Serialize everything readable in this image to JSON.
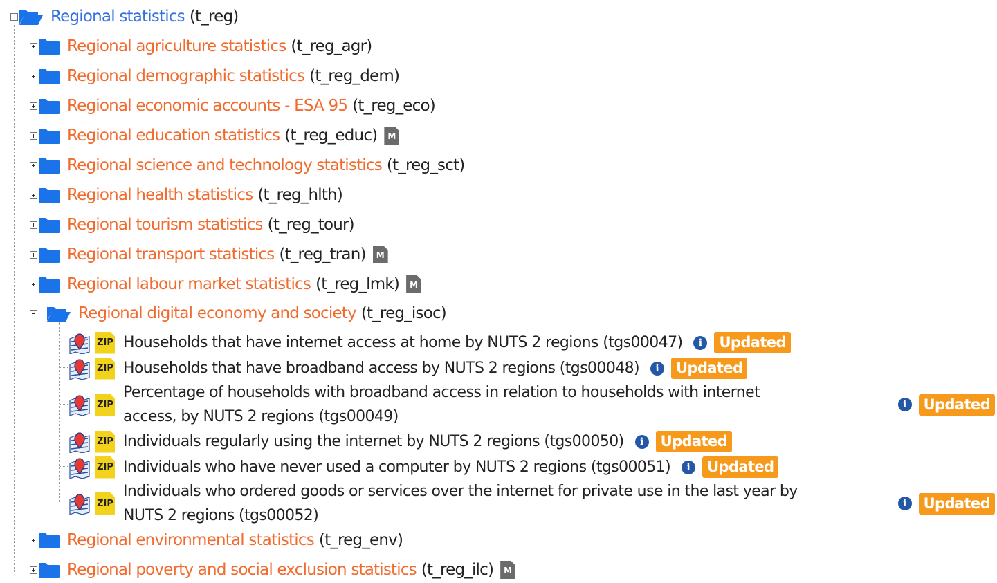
{
  "root": {
    "label": "Regional statistics",
    "code": "(t_reg)"
  },
  "folders_top": [
    {
      "label": "Regional agriculture statistics",
      "code": "(t_reg_agr)",
      "meta": false
    },
    {
      "label": "Regional demographic statistics",
      "code": "(t_reg_dem)",
      "meta": false
    },
    {
      "label": "Regional economic accounts - ESA 95",
      "code": "(t_reg_eco)",
      "meta": false
    },
    {
      "label": "Regional education statistics",
      "code": "(t_reg_educ)",
      "meta": true
    },
    {
      "label": "Regional science and technology statistics",
      "code": "(t_reg_sct)",
      "meta": false
    },
    {
      "label": "Regional health statistics",
      "code": "(t_reg_hlth)",
      "meta": false
    },
    {
      "label": "Regional tourism statistics",
      "code": "(t_reg_tour)",
      "meta": false
    },
    {
      "label": "Regional transport statistics",
      "code": "(t_reg_tran)",
      "meta": true
    },
    {
      "label": "Regional labour market statistics",
      "code": "(t_reg_lmk)",
      "meta": true
    }
  ],
  "open_folder": {
    "label": "Regional digital economy and society",
    "code": "(t_reg_isoc)"
  },
  "datasets": [
    {
      "text": "Households that have internet access at home by NUTS 2 regions (tgs00047)"
    },
    {
      "text": "Households that have broadband access by NUTS 2 regions (tgs00048)"
    },
    {
      "line1": "Percentage of households with broadband access in relation to households with internet",
      "line2": "access, by NUTS 2 regions (tgs00049)"
    },
    {
      "text": "Individuals regularly using the internet by NUTS 2 regions (tgs00050)"
    },
    {
      "text": "Individuals who have never used a computer by NUTS 2 regions (tgs00051)"
    },
    {
      "line1": "Individuals who ordered goods or services over the internet for private use in the last year by",
      "line2": "NUTS 2 regions (tgs00052)"
    }
  ],
  "folders_bottom": [
    {
      "label": "Regional environmental statistics",
      "code": "(t_reg_env)",
      "meta": false
    },
    {
      "label": "Regional poverty and social exclusion statistics",
      "code": "(t_reg_ilc)",
      "meta": true
    }
  ],
  "badge_label": "Updated",
  "zip_label": "ZIP",
  "meta_label": "M",
  "info_glyph": "i",
  "colors": {
    "blue_link": "#3370e0",
    "orange_link": "#f26b2e",
    "folder_blue": "#1a73e8",
    "badge": "#f79a1c",
    "zip": "#f3d21b",
    "info": "#2457a6"
  },
  "icons": {
    "folder": "folder-icon",
    "folder_open": "folder-open-icon",
    "map": "map-marker-icon",
    "zip": "zip-icon",
    "metadata": "metadata-icon",
    "info": "info-icon"
  }
}
